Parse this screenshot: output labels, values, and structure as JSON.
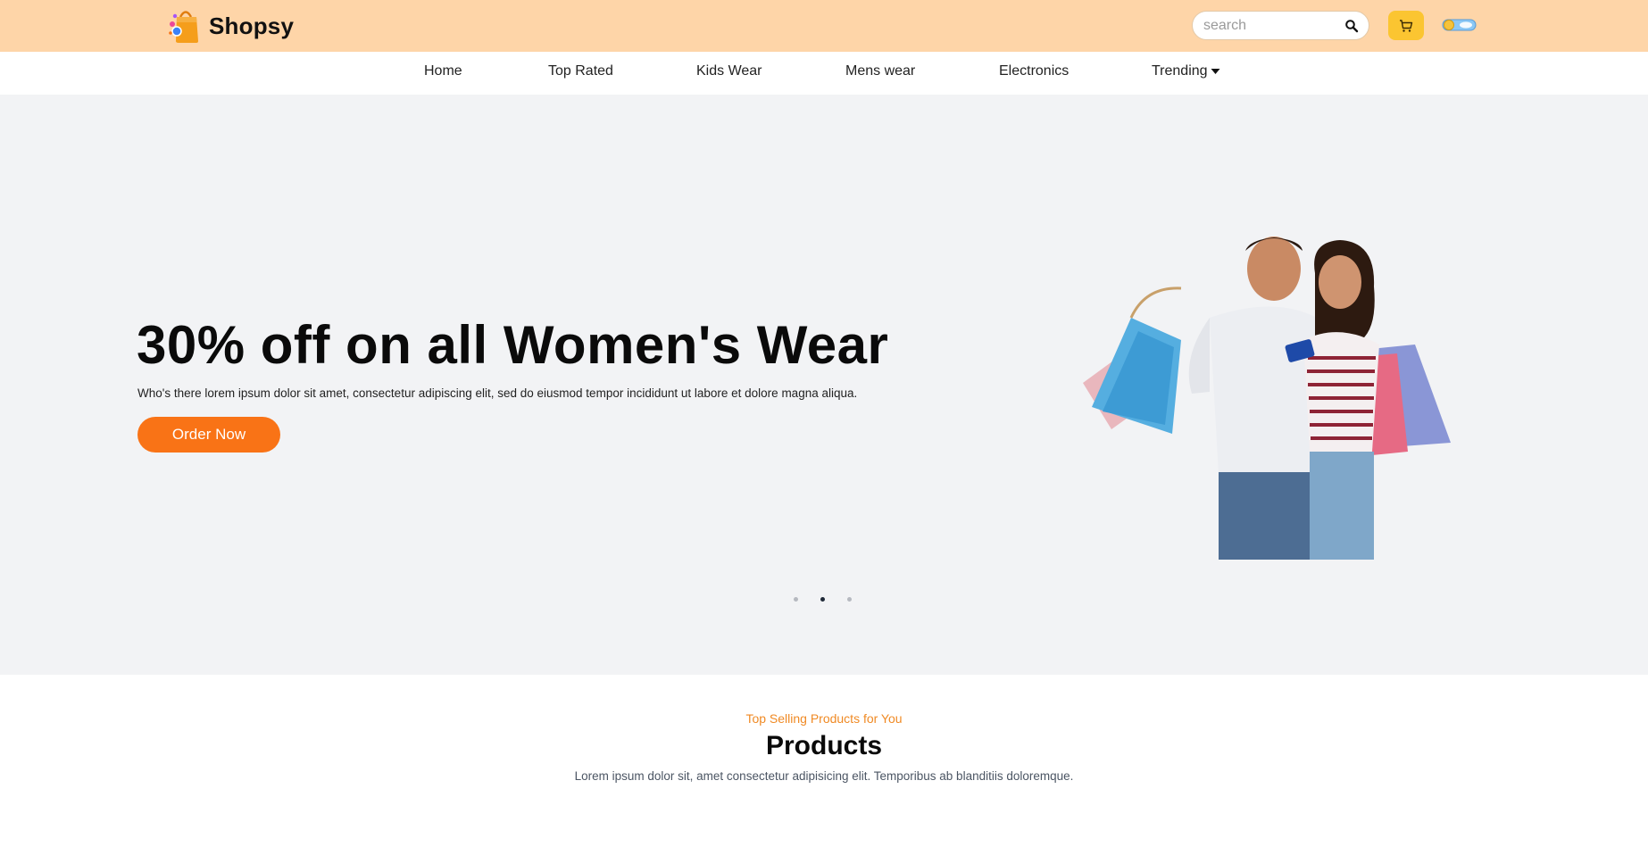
{
  "header": {
    "brand": "Shopsy",
    "search_placeholder": "search",
    "icons": {
      "logo": "shopping-bag-icon",
      "search": "search-icon",
      "cart": "cart-icon",
      "theme_toggle": "theme-toggle-icon"
    },
    "colors": {
      "bar": "#fed5a8",
      "cart_button": "#fbc531"
    }
  },
  "nav": {
    "items": [
      {
        "label": "Home"
      },
      {
        "label": "Top Rated"
      },
      {
        "label": "Kids Wear"
      },
      {
        "label": "Mens wear"
      },
      {
        "label": "Electronics"
      },
      {
        "label": "Trending",
        "icon": "caret-down-icon"
      }
    ]
  },
  "hero": {
    "title": "30% off on all Women's Wear",
    "description": "Who's there lorem ipsum dolor sit amet, consectetur adipiscing elit, sed do eiusmod tempor incididunt ut labore et dolore magna aliqua.",
    "cta_label": "Order Now",
    "image_icon": "shopping-couple-image",
    "slides_total": 3,
    "active_slide": 2,
    "colors": {
      "background": "#f2f3f5",
      "cta": "#f97316"
    }
  },
  "products": {
    "eyebrow": "Top Selling Products for You",
    "title": "Products",
    "description": "Lorem ipsum dolor sit, amet consectetur adipisicing elit. Temporibus ab blanditiis doloremque.",
    "colors": {
      "eyebrow": "#f08a24"
    }
  }
}
